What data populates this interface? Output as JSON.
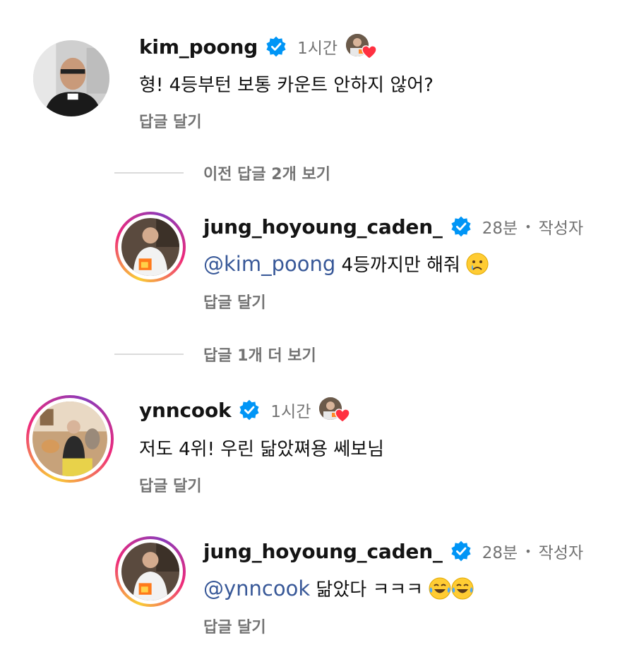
{
  "comments": [
    {
      "username": "kim_poong",
      "time": "1시간",
      "text": "형! 4등부턴 보통 카운트 안하지 않어?",
      "reply_label": "답글 달기"
    },
    {
      "username": "ynncook",
      "time": "1시간",
      "text": "저도 4위! 우린 닮았쪄용 쎄보님",
      "reply_label": "답글 달기"
    }
  ],
  "replies": [
    {
      "username": "jung_hoyoung_caden_",
      "time": "28분",
      "author_badge": "작성자",
      "mention": "@kim_poong",
      "text": " 4등까지만 해줘",
      "emoji": "crying-face",
      "reply_label": "답글 달기"
    },
    {
      "username": "jung_hoyoung_caden_",
      "time": "28분",
      "author_badge": "작성자",
      "mention": "@ynncook",
      "text": " 닮았다 ㅋㅋㅋ ",
      "emoji": "tears-of-joy",
      "reply_label": "답글 달기"
    }
  ],
  "view_previous": "이전 답글 2개 보기",
  "view_more": "답글 1개 더 보기",
  "colors": {
    "verified": "#0095f6",
    "mention": "#385898",
    "muted": "#737373",
    "heart": "#ff3040"
  }
}
